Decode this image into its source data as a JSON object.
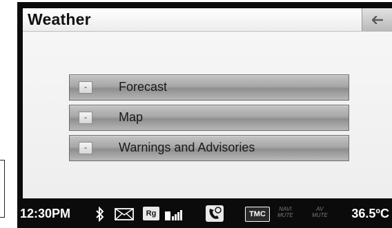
{
  "screen": {
    "title": "Weather",
    "back_icon": "arrow-left-icon"
  },
  "menu": {
    "items": [
      {
        "bullet": "-",
        "label": "Forecast"
      },
      {
        "bullet": "-",
        "label": "Map"
      },
      {
        "bullet": "-",
        "label": "Warnings and Advisories"
      }
    ]
  },
  "status_bar": {
    "time": "12:30PM",
    "icons": [
      "bluetooth-icon",
      "mail-icon",
      "roaming-icon",
      "signal-icon",
      "phone-icon"
    ],
    "roaming_text": "Rg",
    "tmc_label": "TMC",
    "navi_mute": {
      "line1": "NAVI",
      "line2": "MUTE"
    },
    "av_mute": {
      "line1": "AV",
      "line2": "MUTE"
    },
    "temperature": "36.5ºC"
  },
  "colors": {
    "bezel": "#0b0b0b",
    "button_mid": "#a7a7a7",
    "screen_bg": "#f2f2f2"
  }
}
